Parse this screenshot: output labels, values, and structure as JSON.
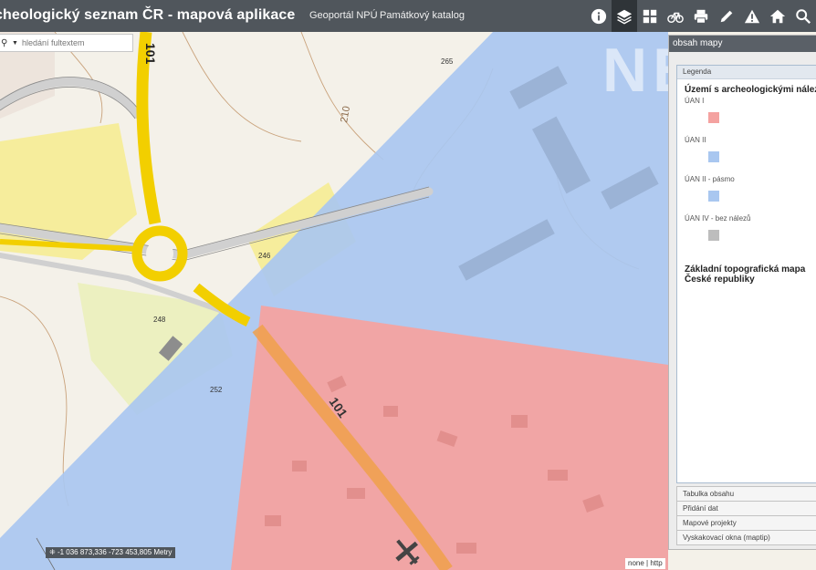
{
  "header": {
    "title": "cheologický seznam ČR - mapová aplikace",
    "links": [
      "Geoportál NPÚ",
      "Památkový katalog"
    ],
    "tools": [
      {
        "icon": "info-icon",
        "glyph": "i"
      },
      {
        "icon": "layers-icon",
        "active": true
      },
      {
        "icon": "grid-icon"
      },
      {
        "icon": "bicycle-icon",
        "glyph": "🚲"
      },
      {
        "icon": "print-icon",
        "glyph": "🖶"
      },
      {
        "icon": "pencil-icon",
        "glyph": "✎"
      },
      {
        "icon": "warning-icon",
        "glyph": "⚠"
      },
      {
        "icon": "home-icon",
        "glyph": "⌂"
      },
      {
        "icon": "search-icon",
        "glyph": "⚲"
      }
    ]
  },
  "search": {
    "placeholder": "hledání fultextem"
  },
  "map": {
    "road_labels": [
      "101",
      "101"
    ],
    "elevation_labels": [
      "210"
    ],
    "building_numbers": [
      "265",
      "246",
      "248",
      "252"
    ],
    "coordinates": "-1 036 873,336 -723 453,805 Metry",
    "attribution": "none | http"
  },
  "watermark": "NEXT",
  "panel": {
    "title": "obsah mapy",
    "legend_tab": "Legenda",
    "legend_group": "Území s archeologickými nálezy",
    "legend_items": [
      {
        "label": "ÚAN I",
        "color": "#f4a2a0"
      },
      {
        "label": "ÚAN II",
        "color": "#a9c7f0"
      },
      {
        "label": "ÚAN II - pásmo",
        "color": "#a9c7f0"
      },
      {
        "label": "ÚAN IV - bez nálezů",
        "color": "#bdbdbd"
      }
    ],
    "base_layer": "Základní topografická mapa České republiky",
    "sections": [
      "Tabulka obsahu",
      "Přidání dat",
      "Mapové projekty",
      "Vyskakovací okna (maptip)"
    ]
  }
}
